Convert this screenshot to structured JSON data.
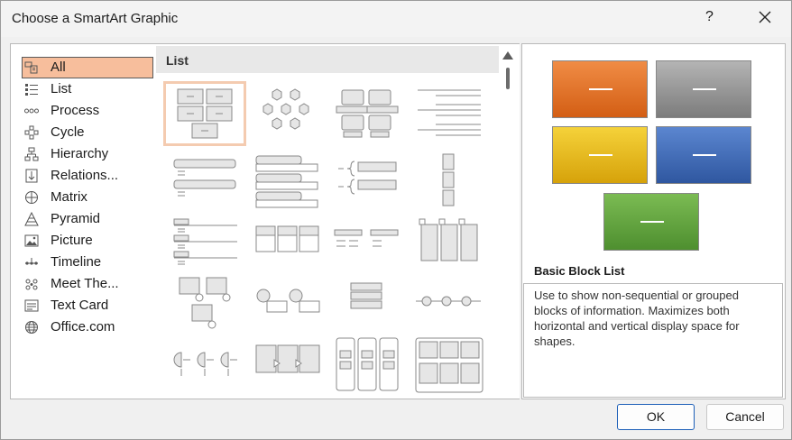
{
  "title": "Choose a SmartArt Graphic",
  "help_label": "?",
  "categories": [
    {
      "label": "All",
      "icon": "all-icon",
      "selected": true
    },
    {
      "label": "List",
      "icon": "list-icon"
    },
    {
      "label": "Process",
      "icon": "process-icon"
    },
    {
      "label": "Cycle",
      "icon": "cycle-icon"
    },
    {
      "label": "Hierarchy",
      "icon": "hierarchy-icon"
    },
    {
      "label": "Relations...",
      "icon": "relationship-icon"
    },
    {
      "label": "Matrix",
      "icon": "matrix-icon"
    },
    {
      "label": "Pyramid",
      "icon": "pyramid-icon"
    },
    {
      "label": "Picture",
      "icon": "picture-icon"
    },
    {
      "label": "Timeline",
      "icon": "timeline-icon"
    },
    {
      "label": "Meet The...",
      "icon": "meet-the-team-icon"
    },
    {
      "label": "Text Card",
      "icon": "text-card-icon"
    },
    {
      "label": "Office.com",
      "icon": "globe-icon"
    }
  ],
  "gallery": {
    "section_header": "List"
  },
  "preview": {
    "name": "Basic Block List",
    "description": "Use to show non-sequential or grouped blocks of information. Maximizes both horizontal and vertical display space for shapes.",
    "block_colors": [
      "#e36c1f",
      "#8c8c8c",
      "#e5b20f",
      "#3a66b0",
      "#5e9f3c"
    ]
  },
  "buttons": {
    "ok": "OK",
    "cancel": "Cancel"
  },
  "colors": {
    "selection": "#f7be9c",
    "accent": "#1c5fb8"
  }
}
